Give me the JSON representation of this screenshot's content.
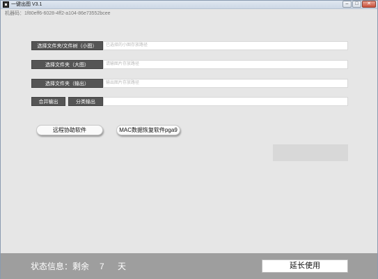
{
  "window": {
    "title": "一键出图 V3.1",
    "minimize_glyph": "–",
    "maximize_glyph": "□",
    "close_glyph": "✕"
  },
  "machine_code": "机器码：1f80eff6-6028-4ff2-a104-86e73552bcee",
  "rows": [
    {
      "button": "选择文件夹/文件树（小图）",
      "placeholder": "已选择的小图存放路径"
    },
    {
      "button": "选择文件夹（大图）",
      "placeholder": "请输图片存放路径"
    },
    {
      "button": "选择文件夹（输出）",
      "placeholder": "输出图片存放路径"
    }
  ],
  "output_row": {
    "merge_button": "合并输出",
    "classify_button": "分类输出",
    "value": ""
  },
  "buttons": {
    "remote_assist": "远程协助软件",
    "mac_recovery": "MAC数据恢复软件pga9"
  },
  "status": {
    "label": "状态信息：剩余",
    "days": "7",
    "unit": "天",
    "extend_button": "延长使用"
  },
  "colors": {
    "background": "#e6e6e6",
    "dark_button": "#555555",
    "status_bar": "#9e9e9e"
  }
}
